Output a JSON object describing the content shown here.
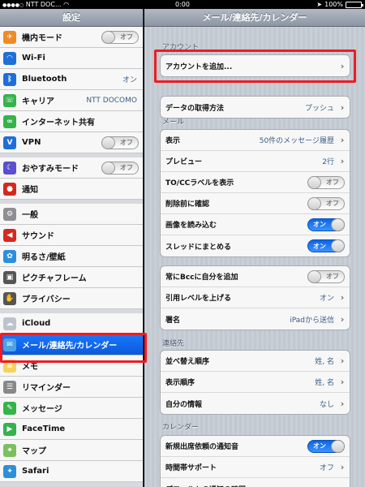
{
  "status": {
    "carrier": "NTT DOC...",
    "time": "0:00",
    "battery": "100%",
    "battery_level": 1.0
  },
  "master": {
    "title": "設定",
    "rows": [
      {
        "label": "機内モード",
        "icon": "airplane-icon",
        "color": "#f08a24",
        "toggle": "オフ"
      },
      {
        "label": "Wi-Fi",
        "icon": "wifi-icon",
        "color": "#1e6fd8"
      },
      {
        "label": "Bluetooth",
        "icon": "bluetooth-icon",
        "color": "#1e6fd8",
        "value": "オン"
      },
      {
        "label": "キャリア",
        "icon": "phone-icon",
        "color": "#35b34a",
        "value": "NTT DOCOMO"
      },
      {
        "label": "インターネット共有",
        "icon": "link-icon",
        "color": "#35b34a"
      },
      {
        "label": "VPN",
        "icon": "vpn-icon",
        "color": "#1e6fd8",
        "toggle": "オフ"
      },
      {
        "label": "おやすみモード",
        "icon": "moon-icon",
        "color": "#5a4fcf",
        "toggle": "オフ"
      },
      {
        "label": "通知",
        "icon": "notification-icon",
        "color": "#d6281f"
      },
      {
        "label": "一般",
        "icon": "gear-icon",
        "color": "#8e8e93"
      },
      {
        "label": "サウンド",
        "icon": "speaker-icon",
        "color": "#d6281f"
      },
      {
        "label": "明るさ/壁紙",
        "icon": "flower-icon",
        "color": "#2c8fdd"
      },
      {
        "label": "ピクチャフレーム",
        "icon": "frame-icon",
        "color": "#555555"
      },
      {
        "label": "プライバシー",
        "icon": "hand-icon",
        "color": "#555555"
      },
      {
        "label": "iCloud",
        "icon": "cloud-icon",
        "color": "#bcc3cc"
      },
      {
        "label": "メール/連絡先/カレンダー",
        "icon": "mail-icon",
        "color": "#4aa3e8"
      },
      {
        "label": "メモ",
        "icon": "notes-icon",
        "color": "#f5d35c"
      },
      {
        "label": "リマインダー",
        "icon": "reminders-icon",
        "color": "#888888"
      },
      {
        "label": "メッセージ",
        "icon": "messages-icon",
        "color": "#35b34a"
      },
      {
        "label": "FaceTime",
        "icon": "camera-icon",
        "color": "#35b34a"
      },
      {
        "label": "マップ",
        "icon": "map-icon",
        "color": "#7cbf5f"
      },
      {
        "label": "Safari",
        "icon": "compass-icon",
        "color": "#2c8fdd"
      }
    ]
  },
  "detail": {
    "title": "メール/連絡先/カレンダー",
    "sections": {
      "account": "アカウント",
      "mail": "メール",
      "contacts": "連絡先",
      "calendar": "カレンダー"
    },
    "add_account": "アカウントを追加...",
    "fetch": {
      "label": "データの取得方法",
      "value": "プッシュ"
    },
    "mail_rows": [
      {
        "label": "表示",
        "value": "50件のメッセージ履歴"
      },
      {
        "label": "プレビュー",
        "value": "2行"
      },
      {
        "label": "TO/CCラベルを表示",
        "toggle": "オフ"
      },
      {
        "label": "削除前に確認",
        "toggle": "オフ"
      },
      {
        "label": "画像を読み込む",
        "toggle": "オン"
      },
      {
        "label": "スレッドにまとめる",
        "toggle": "オン"
      }
    ],
    "mail_rows2": [
      {
        "label": "常にBccに自分を追加",
        "toggle": "オフ"
      },
      {
        "label": "引用レベルを上げる",
        "value": "オン"
      },
      {
        "label": "署名",
        "value": "iPadから送信"
      }
    ],
    "contact_rows": [
      {
        "label": "並べ替え順序",
        "value": "姓, 名"
      },
      {
        "label": "表示順序",
        "value": "姓, 名"
      },
      {
        "label": "自分の情報",
        "value": "なし"
      }
    ],
    "calendar_rows": [
      {
        "label": "新規出席依頼の通知音",
        "toggle": "オン"
      },
      {
        "label": "時間帯サポート",
        "value": "オフ"
      },
      {
        "label": "デフォルトの通知の時間"
      }
    ]
  }
}
